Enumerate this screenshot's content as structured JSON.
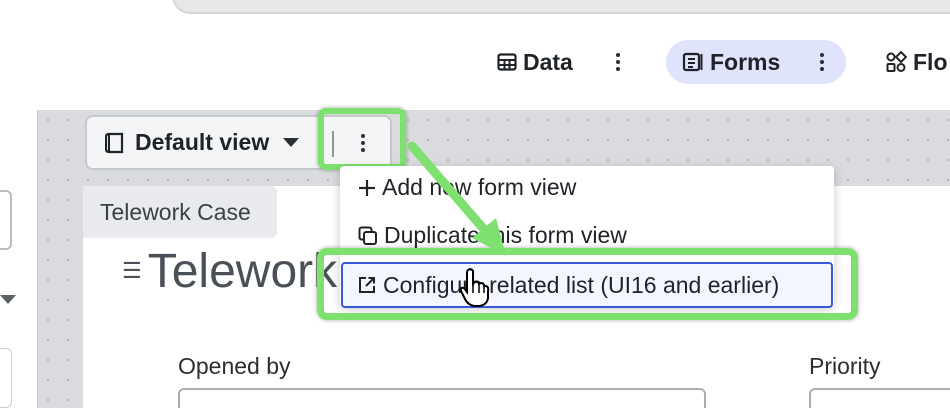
{
  "tabs": {
    "data": {
      "label": "Data",
      "icon": "table-icon"
    },
    "forms": {
      "label": "Forms",
      "icon": "form-icon",
      "active": true
    },
    "flows": {
      "label": "Flo",
      "icon": "flow-icon"
    }
  },
  "view_selector": {
    "label": "Default view",
    "icon": "notebook-icon"
  },
  "menu": {
    "items": [
      {
        "label": "Add new form view",
        "icon": "plus-icon"
      },
      {
        "label": "Duplicate this form view",
        "icon": "copy-icon"
      },
      {
        "label": "Configure related list (UI16 and earlier)",
        "icon": "external-link-icon",
        "highlighted": true
      }
    ]
  },
  "form": {
    "tag": "Telework Case",
    "title": "Telework Case",
    "fields": {
      "opened_by": "Opened by",
      "priority": "Priority"
    }
  },
  "colors": {
    "active_tab_bg": "#dfe3fb",
    "highlight_green": "#7ee06f",
    "focus_blue": "#3a59d6",
    "canvas_bg": "#d9dbde"
  }
}
